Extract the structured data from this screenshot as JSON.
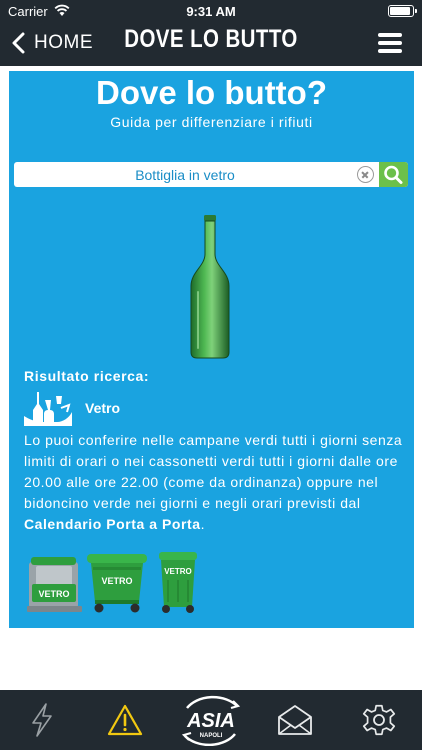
{
  "status_bar": {
    "carrier": "Carrier",
    "time": "9:31 AM"
  },
  "nav": {
    "back_label": "HOME",
    "title": "DOVE LO BUTTO"
  },
  "page": {
    "title": "Dove lo butto?",
    "subtitle": "Guida per differenziare i rifiuti"
  },
  "search": {
    "value": "Bottiglia in vetro"
  },
  "result": {
    "heading": "Risultato ricerca:",
    "category": "Vetro",
    "description_parts": [
      "Lo puoi conferire nelle campane verdi tutti i giorni senza limiti di orari o nei cassonetti verdi tutti i giorni dalle ore 20.00 alle ore 22.00 (come da ordinanza) oppure nel bidoncino verde nei giorni e negli orari previsti dal ",
      "Calendario Porta a Porta",
      "."
    ],
    "bins": [
      {
        "label": "VETRO",
        "icon": "bell-container-icon"
      },
      {
        "label": "VETRO",
        "icon": "wheeled-dumpster-icon"
      },
      {
        "label": "VETRO",
        "icon": "small-bin-icon"
      }
    ]
  },
  "tabbar": {
    "items": [
      {
        "icon": "lightning-icon"
      },
      {
        "icon": "warning-icon"
      },
      {
        "icon": "asia-logo",
        "logo_text": "ASIA",
        "logo_sub": "NAPOLI"
      },
      {
        "icon": "mail-icon"
      },
      {
        "icon": "gear-icon"
      }
    ]
  },
  "colors": {
    "panel_blue": "#1aa3e0",
    "bar_dark": "#222a31",
    "search_green": "#6cc04a",
    "bin_green": "#2e9e3e",
    "warning_yellow": "#f2c811"
  }
}
